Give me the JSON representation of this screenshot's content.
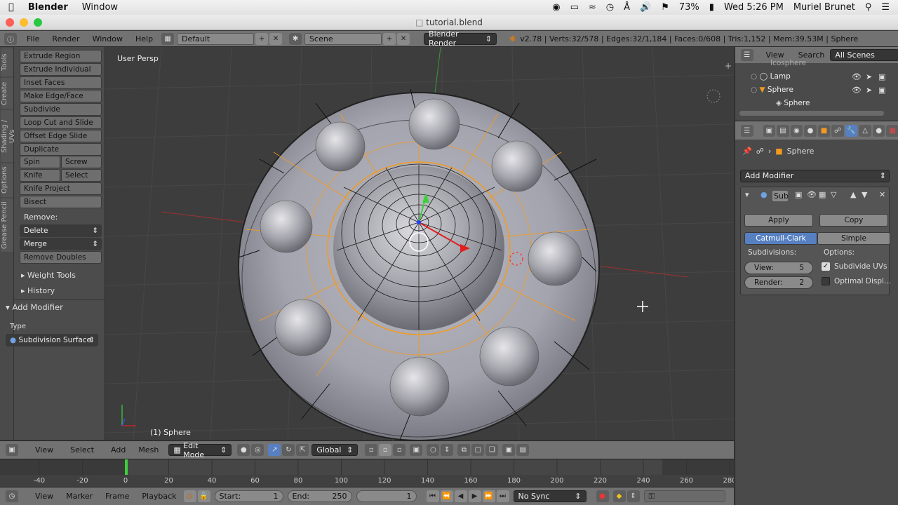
{
  "mac_menubar": {
    "apple_icon": "apple-icon",
    "app_name": "Blender",
    "menu_window": "Window",
    "battery": "73%",
    "clock": "Wed 5:26 PM",
    "user": "Muriel Brunet"
  },
  "window": {
    "title": "tutorial.blend"
  },
  "info_header": {
    "menus": [
      "File",
      "Render",
      "Window",
      "Help"
    ],
    "layout": "Default",
    "scene": "Scene",
    "engine": "Blender Render",
    "stats": "v2.78 | Verts:32/578 | Edges:32/1,184 | Faces:0/608 | Tris:1,152 | Mem:39.53M | Sphere"
  },
  "toolshelf": {
    "tabs": [
      "Tools",
      "Create",
      "Shading / UVs",
      "Options",
      "Grease Pencil"
    ],
    "buttons": [
      "Extrude Region",
      "Extrude Individual",
      "Inset Faces",
      "Make Edge/Face",
      "Subdivide",
      "Loop Cut and Slide",
      "Offset Edge Slide",
      "Duplicate"
    ],
    "spin": "Spin",
    "screw": "Screw",
    "knife": "Knife",
    "select": "Select",
    "knife_project": "Knife Project",
    "bisect": "Bisect",
    "remove_label": "Remove:",
    "delete": "Delete",
    "merge": "Merge",
    "remove_doubles": "Remove Doubles",
    "weight_tools": "Weight Tools",
    "history": "History",
    "add_modifier": "Add Modifier",
    "type_label": "Type",
    "type_value": "Subdivision Surface"
  },
  "viewport": {
    "view_name": "User Persp",
    "object_label": "(1) Sphere"
  },
  "outliner": {
    "view": "View",
    "search": "Search",
    "all_scenes": "All Scenes",
    "items": [
      "Lamp",
      "Sphere",
      "Sphere"
    ],
    "partial_item": "Icosphere"
  },
  "properties": {
    "breadcrumb": "Sphere",
    "add_modifier": "Add Modifier",
    "mod_name": "Sub",
    "apply": "Apply",
    "copy": "Copy",
    "catmull": "Catmull-Clark",
    "simple": "Simple",
    "subdivisions_label": "Subdivisions:",
    "options_label": "Options:",
    "view_label": "View:",
    "view_value": "5",
    "render_label": "Render:",
    "render_value": "2",
    "subdivide_uvs": "Subdivide UVs",
    "subdivide_uvs_checked": true,
    "optimal_display": "Optimal Displ...",
    "optimal_checked": false
  },
  "view3d_header": {
    "menus": [
      "View",
      "Select",
      "Add",
      "Mesh"
    ],
    "mode": "Edit Mode",
    "orientation": "Global"
  },
  "timeline": {
    "ticks": [
      "-40",
      "-20",
      "0",
      "20",
      "40",
      "60",
      "80",
      "100",
      "120",
      "140",
      "160",
      "180",
      "200",
      "220",
      "240",
      "260",
      "280"
    ],
    "current_frame": 0
  },
  "timeline_header": {
    "menus": [
      "View",
      "Marker",
      "Frame",
      "Playback"
    ],
    "start_label": "Start:",
    "start_value": "1",
    "end_label": "End:",
    "end_value": "250",
    "frame_value": "1",
    "sync": "No Sync"
  },
  "colors": {
    "accent_blue": "#5680c2",
    "select_orange": "#f39a1f",
    "grid": "#474747"
  }
}
